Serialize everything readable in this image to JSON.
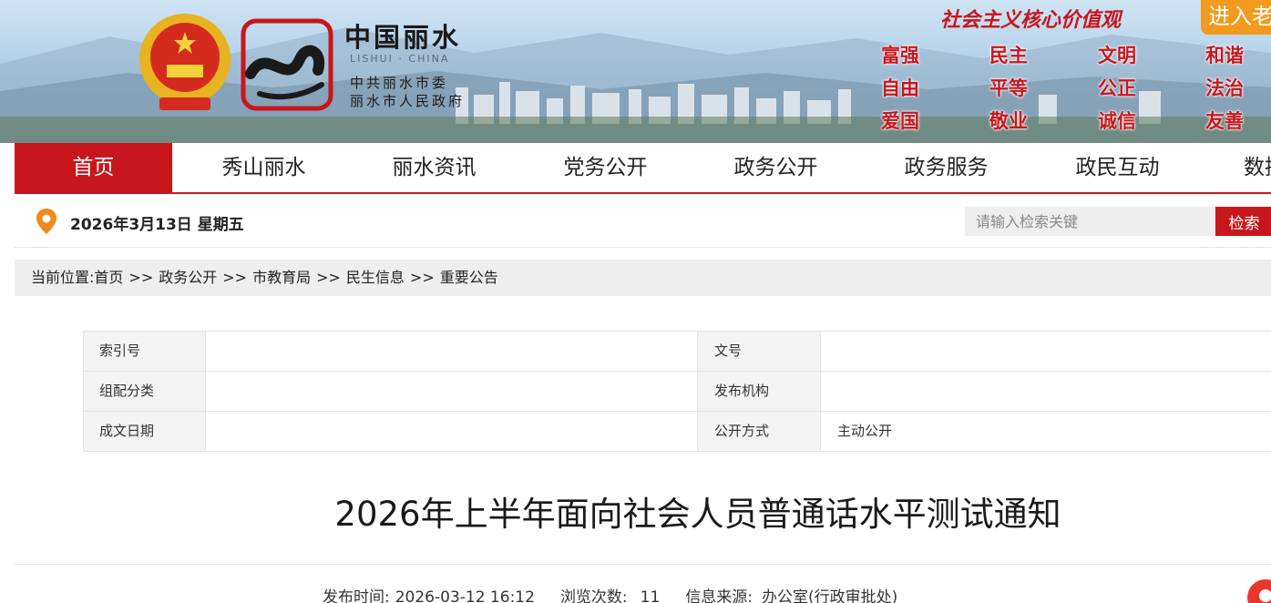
{
  "banner": {
    "city_name": "中国丽水",
    "city_en": "LISHUI · CHINA",
    "party_name": "中共丽水市委",
    "gov_name": "丽水市人民政府",
    "core_values_title": "社会主义核心价值观",
    "enter_label": "进入老",
    "values": [
      [
        "富强",
        "自由",
        "爱国"
      ],
      [
        "民主",
        "平等",
        "敬业"
      ],
      [
        "文明",
        "公正",
        "诚信"
      ],
      [
        "和谐",
        "法治",
        "友善"
      ]
    ]
  },
  "nav": {
    "items": [
      "首页",
      "秀山丽水",
      "丽水资讯",
      "党务公开",
      "政务公开",
      "政务服务",
      "政民互动",
      "数据"
    ],
    "active_index": 0,
    "accent_color": "#c8161d"
  },
  "infobar": {
    "date": "2026年3月13日 星期五",
    "search_placeholder": "请输入检索关键",
    "search_button": "检索"
  },
  "breadcrumb": {
    "prefix": "当前位置:",
    "items": [
      "首页",
      "政务公开",
      "市教育局",
      "民生信息",
      "重要公告"
    ],
    "separator": ">>"
  },
  "meta": {
    "rows": [
      {
        "label1": "索引号",
        "value1": "",
        "label2": "文号",
        "value2": ""
      },
      {
        "label1": "组配分类",
        "value1": "",
        "label2": "发布机构",
        "value2": ""
      },
      {
        "label1": "成文日期",
        "value1": "",
        "label2": "公开方式",
        "value2": "主动公开"
      }
    ]
  },
  "article": {
    "title": "2026年上半年面向社会人员普通话水平测试通知",
    "publish_time_label": "发布时间:",
    "publish_time": "2026-03-12 16:12",
    "views_label": "浏览次数:",
    "views": "11",
    "source_label": "信息来源:",
    "source": "办公室(行政审批处)"
  }
}
